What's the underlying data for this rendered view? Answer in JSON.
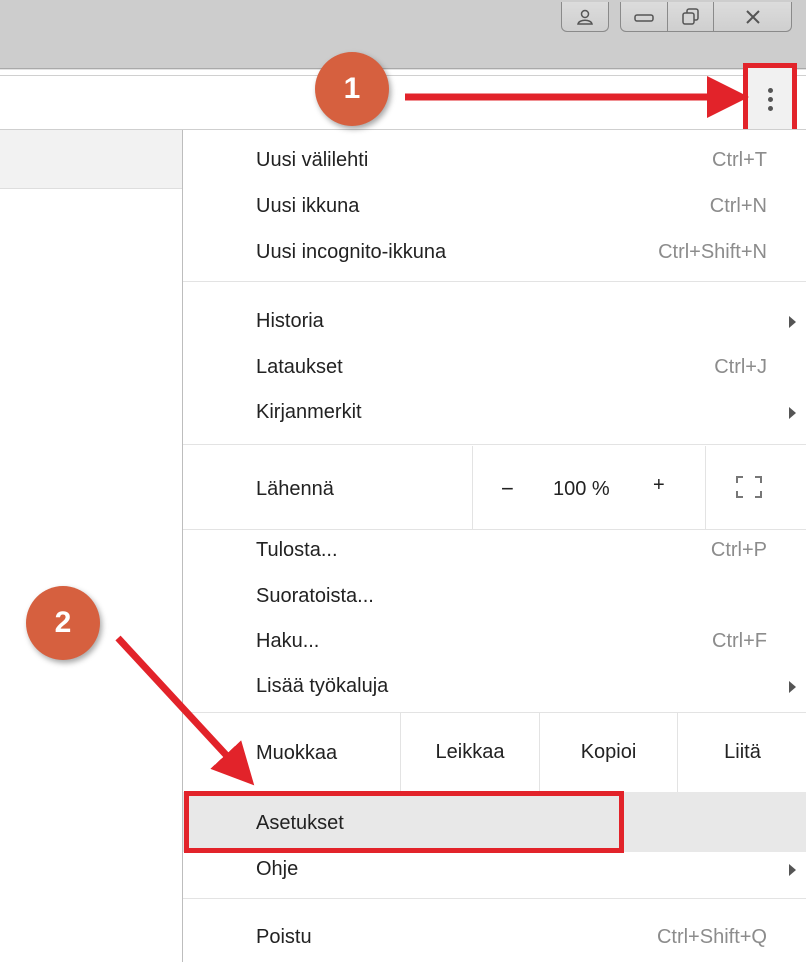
{
  "menu": {
    "new_section": [
      {
        "label": "Uusi välilehti",
        "shortcut": "Ctrl+T"
      },
      {
        "label": "Uusi ikkuna",
        "shortcut": "Ctrl+N"
      },
      {
        "label": "Uusi incognito-ikkuna",
        "shortcut": "Ctrl+Shift+N"
      }
    ],
    "history_section": [
      {
        "label": "Historia"
      },
      {
        "label": "Lataukset",
        "shortcut": "Ctrl+J"
      },
      {
        "label": "Kirjanmerkit"
      }
    ],
    "zoom": {
      "label": "Lähennä",
      "minus": "−",
      "value": "100 %",
      "plus": "+"
    },
    "tools_section": [
      {
        "label": "Tulosta...",
        "shortcut": "Ctrl+P"
      },
      {
        "label": "Suoratoista..."
      },
      {
        "label": "Haku...",
        "shortcut": "Ctrl+F"
      },
      {
        "label": "Lisää työkaluja"
      }
    ],
    "edit": {
      "label": "Muokkaa",
      "cut": "Leikkaa",
      "copy": "Kopioi",
      "paste": "Liitä"
    },
    "settings": "Asetukset",
    "help": "Ohje",
    "exit": {
      "label": "Poistu",
      "shortcut": "Ctrl+Shift+Q"
    }
  },
  "annotations": {
    "step1": "1",
    "step2": "2",
    "highlight_color": "#e2232a",
    "badge_color": "#d6603f"
  },
  "icons": {
    "menu_button": "kebab-vertical-icon",
    "window_buttons": [
      "user-icon",
      "minimize-icon",
      "maximize-icon",
      "close-icon"
    ],
    "fullscreen": "fullscreen-icon",
    "submenu": "chevron-right-icon"
  }
}
